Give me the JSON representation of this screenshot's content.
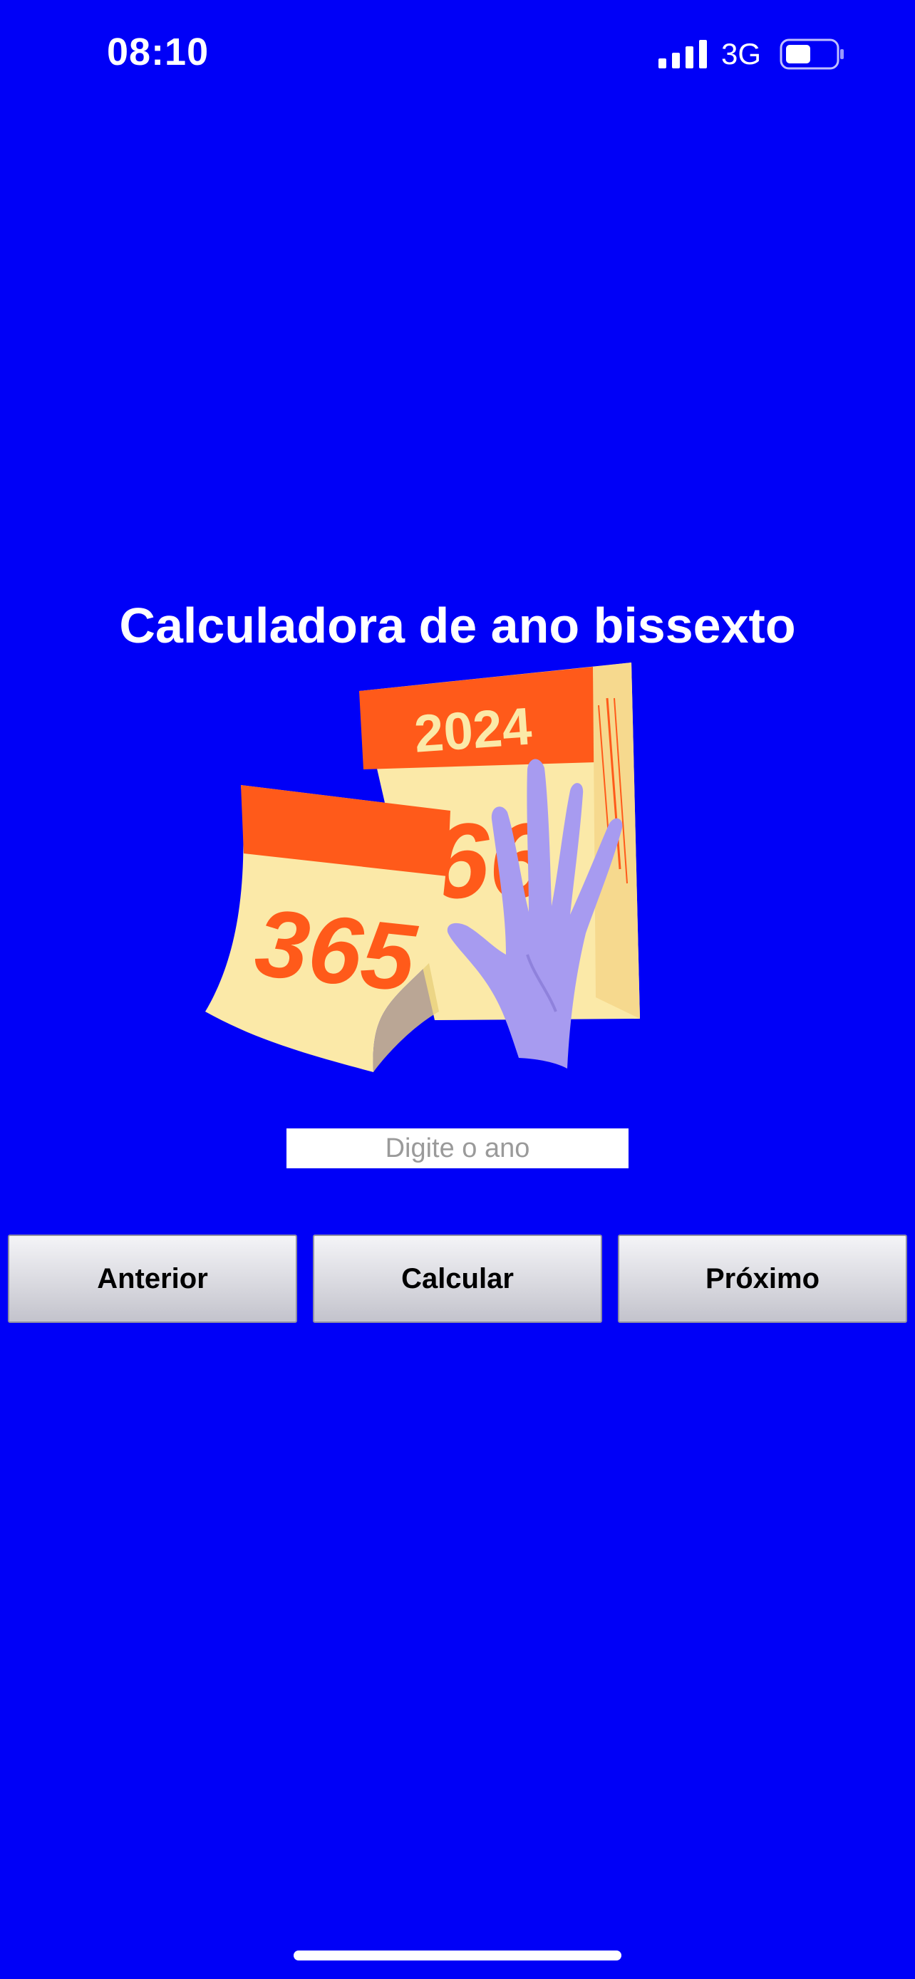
{
  "status_bar": {
    "time": "08:10",
    "network": "3G",
    "icons": [
      "signal-icon",
      "battery-icon"
    ]
  },
  "title": "Calculadora de ano bissexto",
  "illustration": {
    "calendar_back_year": "2024",
    "calendar_back_number": "66",
    "calendar_front_number": "365"
  },
  "year_input": {
    "placeholder": "Digite o ano",
    "value": ""
  },
  "buttons": {
    "previous": "Anterior",
    "calculate": "Calcular",
    "next": "Próximo"
  },
  "colors": {
    "background": "#0000f7",
    "calendar_red": "#ff5a1a",
    "calendar_paper": "#fbe9a8",
    "hand": "#a79bf0"
  }
}
